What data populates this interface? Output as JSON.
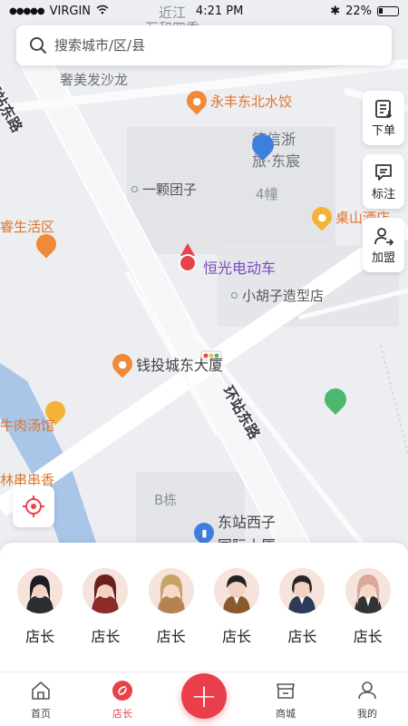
{
  "status_bar": {
    "carrier": "VIRGIN",
    "time": "4:21 PM",
    "battery": "22%"
  },
  "search": {
    "placeholder": "搜索城市/区/县"
  },
  "side_actions": [
    {
      "label": "下单",
      "icon": "order-icon"
    },
    {
      "label": "标注",
      "icon": "annotate-icon"
    },
    {
      "label": "加盟",
      "icon": "join-icon"
    }
  ],
  "map": {
    "roads": [
      "环站东路",
      "环站东路"
    ],
    "pois": {
      "dumpling": "永丰东北水饺",
      "sofa": "奢美发沙龙",
      "xinzhe": "德信浙",
      "xinzhe2": "旅·东宸",
      "tuanzi": "一颗团子",
      "building4": "4幢",
      "shenghuoqu": "睿生活区",
      "current": "恒光电动车",
      "hair": "小胡子造型店",
      "qiantou": "钱投城东大厦",
      "beef": "牛肉汤馆",
      "lin": "林串串香",
      "bdong": "B栋",
      "dongzhan": "东站西子",
      "dongzhan2": "国际大厦",
      "taoshan": "桌山酒店",
      "jinjin": "近江",
      "wanhe": "万和四季"
    }
  },
  "managers": [
    {
      "label": "店长"
    },
    {
      "label": "店长"
    },
    {
      "label": "店长"
    },
    {
      "label": "店长"
    },
    {
      "label": "店长"
    },
    {
      "label": "店长"
    }
  ],
  "tabs": [
    {
      "label": "首页",
      "icon": "home-icon"
    },
    {
      "label": "店长",
      "icon": "manager-icon",
      "active": true
    },
    {
      "label": "",
      "icon": "add-icon"
    },
    {
      "label": "商城",
      "icon": "shop-icon"
    },
    {
      "label": "我的",
      "icon": "profile-icon"
    }
  ],
  "colors": {
    "accent": "#ea3e4b",
    "poi_orange": "#f08a3a",
    "poi_blue": "#3d7fdd",
    "poi_green": "#4cb86e"
  }
}
